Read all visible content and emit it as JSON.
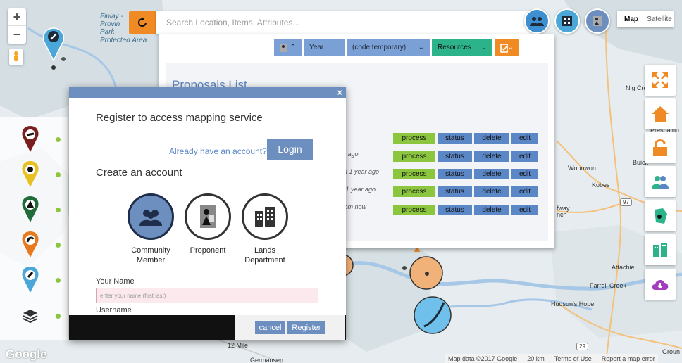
{
  "map": {
    "labels": {
      "park_line1": "Finlay -",
      "park_line2": "Provin",
      "park_line3": "Park",
      "park_line4": "Protected Area",
      "nig_creek": "Nig Cree",
      "prespatou": "Prespatou",
      "buick": "Buick",
      "wonowon": "Wonowon",
      "kobes": "Kobes",
      "fway": "fway",
      "nch": "nch",
      "attachie": "Attachie",
      "farrell_creek": "Farrell Creek",
      "hudsons_hope": "Hudson's Hope",
      "twelve_mile": "12 Mile",
      "germansen": "Germansen",
      "ground": "Groun"
    },
    "shields": {
      "hwy97": "97",
      "hwy29": "29"
    },
    "zoom_in": "+",
    "zoom_out": "−",
    "type_map": "Map",
    "type_satellite": "Satellite",
    "google": "Google",
    "attribution": {
      "data": "Map data ©2017 Google",
      "scale": "20 km",
      "terms": "Terms of Use",
      "report": "Report a map error"
    }
  },
  "search": {
    "placeholder": "Search Location, Items, Attributes..."
  },
  "toolbar": {
    "year": "Year",
    "code": "(code temporary)",
    "resources": "Resources"
  },
  "proposals": {
    "title": "Proposals List",
    "rows": [
      {
        "time": "",
        "process": "process",
        "status": "status",
        "delete": "delete",
        "edit": "edit"
      },
      {
        "time": "ar ago",
        "process": "process",
        "status": "status",
        "delete": "delete",
        "edit": "edit"
      },
      {
        "time": "ed 1 year ago",
        "process": "process",
        "status": "status",
        "delete": "delete",
        "edit": "edit"
      },
      {
        "time": "d 1 year ago",
        "process": "process",
        "status": "status",
        "delete": "delete",
        "edit": "edit"
      },
      {
        "time": "from now",
        "process": "process",
        "status": "status",
        "delete": "delete",
        "edit": "edit"
      }
    ]
  },
  "modal": {
    "close": "×",
    "title": "Register to access mapping service",
    "already": "Already have an account?",
    "login": "Login",
    "create": "Create an account",
    "roles": [
      {
        "line1": "Community",
        "line2": "Member",
        "icon": "community-icon"
      },
      {
        "line1": "Proponent",
        "line2": "",
        "icon": "proponent-icon"
      },
      {
        "line1": "Lands",
        "line2": "Department",
        "icon": "building-icon"
      }
    ],
    "name_label": "Your Name",
    "name_placeholder": "enter your name (first last)",
    "username_label": "Username",
    "cancel": "cancel",
    "register": "Register"
  },
  "colors": {
    "accent_blue": "#6d8fbf",
    "process_green": "#8cc63f",
    "orange": "#f08a24",
    "teal": "#2db38a"
  }
}
